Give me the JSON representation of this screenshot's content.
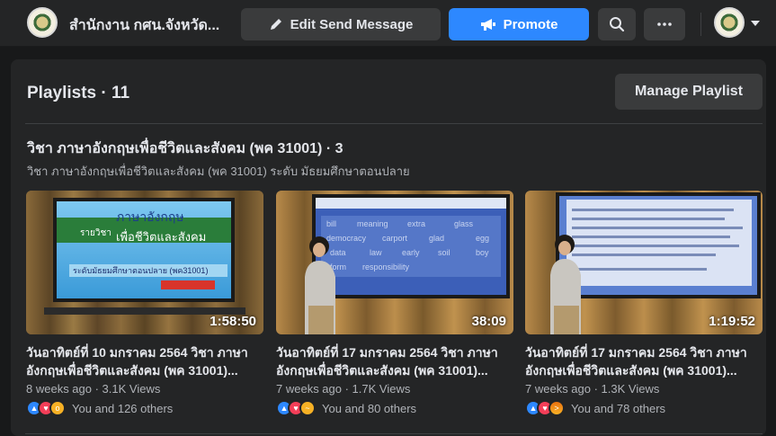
{
  "header": {
    "page_name": "สำนักงาน กศน.จังหวัด...",
    "edit_label": "Edit Send Message",
    "promote_label": "Promote",
    "search_icon": "search-icon",
    "more_icon": "more-icon",
    "edit_icon": "pencil-icon",
    "promote_icon": "megaphone-icon"
  },
  "playlists": {
    "heading": "Playlists · 11",
    "manage_label": "Manage Playlist",
    "current": {
      "title": "วิชา ภาษาอังกฤษเพื่อชีวิตและสังคม (พค 31001) · 3",
      "description": "วิชา ภาษาอังกฤษเพื่อชีวิตและสังคม (พค 31001) ระดับ มัธยมศึกษาตอนปลาย"
    }
  },
  "videos": [
    {
      "duration": "1:58:50",
      "title": "วันอาทิตย์ที่ 10 มกราคม 2564 วิชา ภาษาอังกฤษเพื่อชีวิตและสังคม (พค 31001)...",
      "meta": "8 weeks ago · 3.1K Views",
      "reactions": "You and 126 others",
      "slide_line1": "ภาษาอังกฤษ",
      "slide_line2": "รายวิชา",
      "slide_line3": "เพื่อชีวิตและสังคม",
      "slide_line4": "ระดับมัธยมศึกษาตอนปลาย (พค31001)"
    },
    {
      "duration": "38:09",
      "title": "วันอาทิตย์ที่ 17 มกราคม 2564 วิชา ภาษาอังกฤษเพื่อชีวิตและสังคม (พค 31001)...",
      "meta": "7 weeks ago · 1.7K Views",
      "reactions": "You and 80 others",
      "slide_words": [
        "bill",
        "meaning",
        "extra",
        "glass",
        "democracy",
        "carport",
        "glad",
        "egg",
        "data",
        "law",
        "early",
        "soil",
        "boy",
        "form",
        "responsibility"
      ]
    },
    {
      "duration": "1:19:52",
      "title": "วันอาทิตย์ที่ 17 มกราคม 2564 วิชา ภาษาอังกฤษเพื่อชีวิตและสังคม (พค 31001)...",
      "meta": "7 weeks ago · 1.3K Views",
      "reactions": "You and 78 others"
    }
  ]
}
